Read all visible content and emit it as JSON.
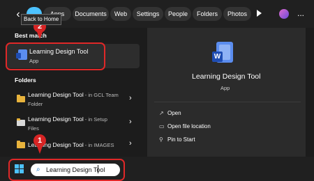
{
  "topbar": {
    "tooltip": "Back to Home",
    "chips": [
      "All",
      "Apps",
      "Documents",
      "Web",
      "Settings",
      "People",
      "Folders",
      "Photos"
    ],
    "more": "..."
  },
  "left": {
    "best_match_title": "Best match",
    "best_match": {
      "title": "Learning Design Tool",
      "subtitle": "App"
    },
    "folders_title": "Folders",
    "folders": [
      {
        "name": "Learning Design Tool",
        "location": " - in GCL Team",
        "location2": "Folder"
      },
      {
        "name": "Learning Design Tool",
        "location": " - in Setup",
        "location2": "Files"
      },
      {
        "name": "Learning Design Tool",
        "location": " - in IMAGES",
        "location2": ""
      }
    ]
  },
  "right": {
    "app_title": "Learning Design Tool",
    "app_type": "App",
    "icon_letter": "W",
    "actions": [
      "Open",
      "Open file location",
      "Pin to Start"
    ]
  },
  "taskbar": {
    "search_value": "Learning Design Tool"
  },
  "annotations": {
    "step1": "1",
    "step2": "2",
    "color": "#e02828"
  }
}
